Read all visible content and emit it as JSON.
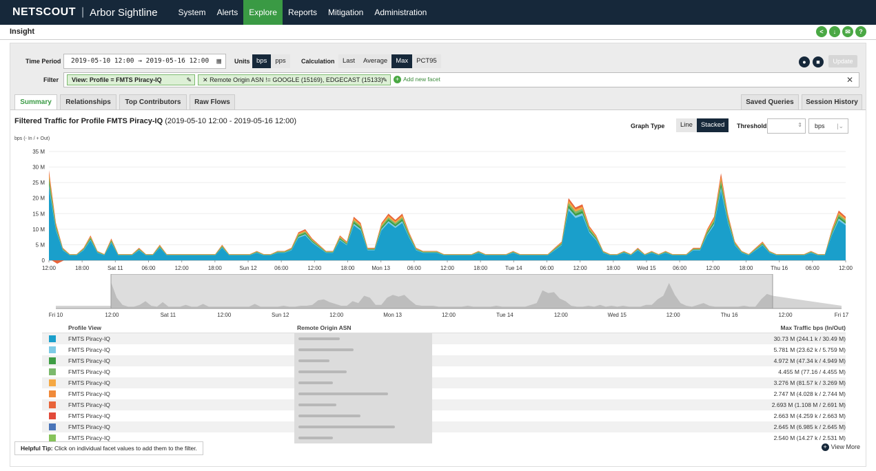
{
  "nav": {
    "brand": "NETSCOUT",
    "product": "Arbor Sightline",
    "items": [
      "System",
      "Alerts",
      "Explore",
      "Reports",
      "Mitigation",
      "Administration"
    ],
    "active": "Explore"
  },
  "page": {
    "title": "Insight"
  },
  "controls": {
    "time_period_label": "Time Period",
    "time_period_value": "2019-05-10 12:00  →  2019-05-16 12:00",
    "units_label": "Units",
    "units": [
      "bps",
      "pps"
    ],
    "units_selected": "bps",
    "calculation_label": "Calculation",
    "calculations": [
      "Last",
      "Average",
      "Max",
      "PCT95"
    ],
    "calculation_selected": "Max",
    "update_label": "Update",
    "filter_label": "Filter",
    "filter_chips": [
      "View: Profile = FMTS Piracy-IQ",
      "Remote Origin ASN != GOOGLE (15169), EDGECAST (15133)"
    ],
    "add_facet_label": "Add new facet"
  },
  "tabs": [
    "Summary",
    "Relationships",
    "Top Contributors",
    "Raw Flows"
  ],
  "tabs_right": [
    "Saved Queries",
    "Session History"
  ],
  "active_tab": "Summary",
  "chart": {
    "title_bold": "Filtered Traffic for Profile FMTS Piracy-IQ",
    "title_range": "(2019-05-10 12:00 - 2019-05-16 12:00)",
    "graph_type_label": "Graph Type",
    "graph_types": [
      "Line",
      "Stacked"
    ],
    "graph_type_selected": "Stacked",
    "threshold_label": "Threshold",
    "threshold_unit": "bps",
    "y_unit": "bps (- In / + Out)"
  },
  "chart_data": {
    "type": "area",
    "ylabel": "bps (- In / + Out)",
    "ylim": [
      0,
      35000000
    ],
    "y_ticks": [
      "0",
      "5 M",
      "10 M",
      "15 M",
      "20 M",
      "25 M",
      "30 M",
      "35 M"
    ],
    "x_ticks": [
      "12:00",
      "18:00",
      "Sat 11",
      "06:00",
      "12:00",
      "18:00",
      "Sun 12",
      "06:00",
      "12:00",
      "18:00",
      "Mon 13",
      "06:00",
      "12:00",
      "18:00",
      "Tue 14",
      "06:00",
      "12:00",
      "18:00",
      "Wed 15",
      "06:00",
      "12:00",
      "18:00",
      "Thu 16",
      "06:00",
      "12:00"
    ],
    "overview_ticks": [
      "Fri 10",
      "12:00",
      "Sat 11",
      "12:00",
      "Sun 12",
      "12:00",
      "Mon 13",
      "12:00",
      "Tue 14",
      "12:00",
      "Wed 15",
      "12:00",
      "Thu 16",
      "12:00",
      "Fri 17"
    ],
    "total_series": [
      29,
      12,
      4,
      2,
      2,
      4,
      8,
      3,
      2,
      7,
      2,
      2,
      2,
      4,
      2,
      2,
      5,
      2,
      2,
      2,
      2,
      2,
      2,
      2,
      2,
      5,
      2,
      2,
      2,
      2,
      3,
      2,
      2,
      3,
      3,
      4,
      9,
      10,
      7,
      5,
      3,
      3,
      8,
      6,
      14,
      12,
      4,
      4,
      12,
      15,
      13,
      15,
      9,
      4,
      3,
      3,
      3,
      2,
      2,
      2,
      2,
      2,
      3,
      2,
      2,
      2,
      2,
      3,
      2,
      2,
      2,
      2,
      2,
      4,
      6,
      20,
      17,
      18,
      11,
      8,
      3,
      2,
      2,
      3,
      2,
      4,
      2,
      3,
      2,
      3,
      2,
      2,
      2,
      4,
      4,
      10,
      14,
      28,
      15,
      6,
      3,
      2,
      4,
      6,
      3,
      2,
      2,
      2,
      2,
      2,
      3,
      2,
      2,
      10,
      16,
      14
    ]
  },
  "table": {
    "headers": [
      "Profile View",
      "Remote Origin ASN",
      "Max Traffic bps (In/Out)"
    ],
    "rows": [
      {
        "profile": "FMTS Piracy-IQ",
        "color": "#1a9fcb",
        "value": "30.73 M (244.1 k / 30.49 M)"
      },
      {
        "profile": "FMTS Piracy-IQ",
        "color": "#7ecbe6",
        "value": "5.781 M (23.62 k / 5.759 M)"
      },
      {
        "profile": "FMTS Piracy-IQ",
        "color": "#3e9d44",
        "value": "4.972 M (47.34 k / 4.949 M)"
      },
      {
        "profile": "FMTS Piracy-IQ",
        "color": "#7cb96e",
        "value": "4.455 M (77.16 / 4.455 M)"
      },
      {
        "profile": "FMTS Piracy-IQ",
        "color": "#f5a844",
        "value": "3.276 M (81.57 k / 3.269 M)"
      },
      {
        "profile": "FMTS Piracy-IQ",
        "color": "#f08a3a",
        "value": "2.747 M (4.028 k / 2.744 M)"
      },
      {
        "profile": "FMTS Piracy-IQ",
        "color": "#e8643a",
        "value": "2.693 M (1.108 M / 2.691 M)"
      },
      {
        "profile": "FMTS Piracy-IQ",
        "color": "#e24a3a",
        "value": "2.663 M (4.259 k / 2.663 M)"
      },
      {
        "profile": "FMTS Piracy-IQ",
        "color": "#4a74b8",
        "value": "2.645 M (6.985 k / 2.645 M)"
      },
      {
        "profile": "FMTS Piracy-IQ",
        "color": "#86c35a",
        "value": "2.540 M (14.27 k / 2.531 M)"
      }
    ]
  },
  "footer": {
    "tip_bold": "Helpful Tip:",
    "tip_text": "Click on individual facet values to add them to the filter.",
    "view_more": "View More"
  }
}
